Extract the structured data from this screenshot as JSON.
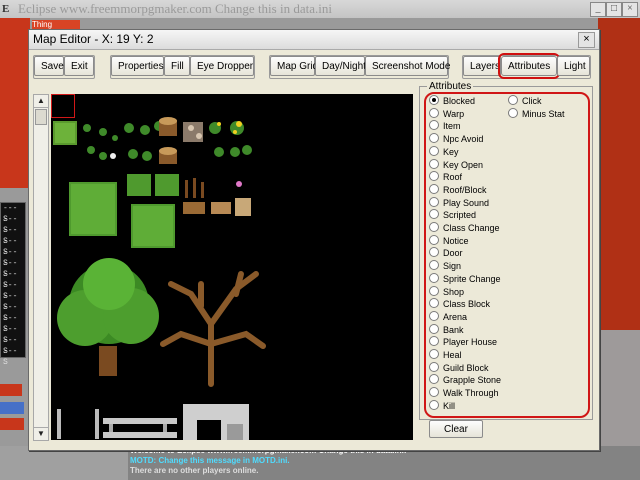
{
  "background": {
    "title": "Eclipse www.freemmorpgmaker.com Change this in data.ini",
    "logo": "E",
    "red_tag": "Thing",
    "list_items": [
      "--- S",
      "--- S",
      "--- S",
      "--- S",
      "--- S",
      "--- S",
      "--- S",
      "--- S",
      "--- S",
      "--- S",
      "--- S",
      "--- S",
      "--- S",
      "--- S"
    ],
    "controls": [
      "_",
      "□",
      "×"
    ]
  },
  "chat": {
    "line1": "Welcome to Eclipse www.freemmorpgmaker.com Change this in data.ini!",
    "line2": "MOTD: Change this message in MOTD.ini.",
    "line3": "There are no other players online."
  },
  "editor": {
    "title": "Map Editor - X: 19 Y: 2",
    "close": "×",
    "toolbar": {
      "group1": [
        "Save",
        "Exit"
      ],
      "group2": [
        "Properties",
        "Fill",
        "Eye Dropper"
      ],
      "group3": [
        "Map Grid",
        "Day/Night",
        "Screenshot Mode"
      ],
      "group4": [
        "Layers",
        "Attributes",
        "Light"
      ]
    },
    "selected_mode": "Attributes",
    "scroll_up": "▲",
    "scroll_down": "▼",
    "attributes": {
      "legend": "Attributes",
      "left_column": [
        "Blocked",
        "Warp",
        "Item",
        "Npc Avoid",
        "Key",
        "Key Open",
        "Roof",
        "Roof/Block",
        "Play Sound",
        "Scripted",
        "Class Change",
        "Notice",
        "Door",
        "Sign",
        "Sprite Change",
        "Shop",
        "Class Block",
        "Arena",
        "Bank",
        "Player House",
        "Heal",
        "Guild Block",
        "Grapple Stone",
        "Walk Through",
        "Kill"
      ],
      "right_column": [
        "Click",
        "Minus Stat"
      ],
      "selected": "Blocked"
    },
    "clear_label": "Clear"
  },
  "colors": {
    "highlight_red": "#d01616",
    "dialog_bg": "#ece9d8",
    "tile_bg": "#000000",
    "motd": "#4fdcff"
  }
}
